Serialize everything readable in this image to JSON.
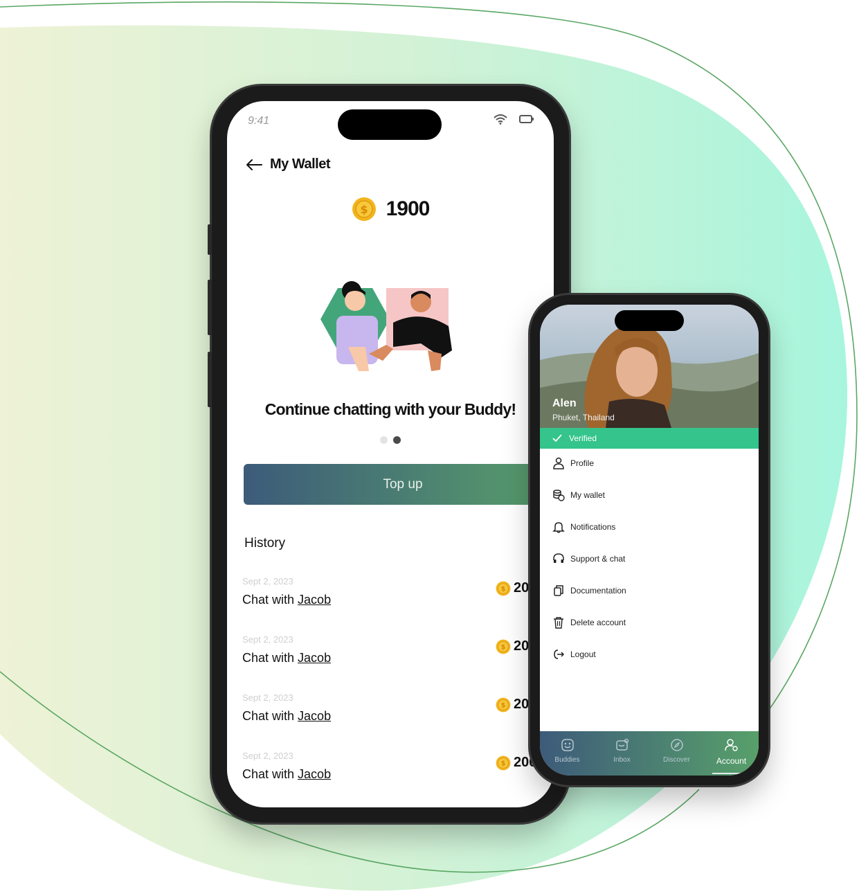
{
  "wallet_screen": {
    "status": {
      "time": "9:41"
    },
    "header": {
      "title": "My Wallet",
      "back_icon": "arrow-left-icon"
    },
    "balance": {
      "value": "1900",
      "icon": "coin-icon"
    },
    "tagline": "Continue chatting with your Buddy!",
    "pager": {
      "count": 2,
      "active": 1
    },
    "topup_label": "Top up",
    "history_title": "History",
    "history": [
      {
        "date": "Sept 2, 2023",
        "prefix": "Chat with ",
        "name": "Jacob",
        "amount": "20"
      },
      {
        "date": "Sept 2, 2023",
        "prefix": "Chat with ",
        "name": "Jacob",
        "amount": "20"
      },
      {
        "date": "Sept 2, 2023",
        "prefix": "Chat with ",
        "name": "Jacob",
        "amount": "20"
      },
      {
        "date": "Sept 2, 2023",
        "prefix": "Chat with ",
        "name": "Jacob",
        "amount": "200"
      }
    ]
  },
  "account_screen": {
    "profile": {
      "name": "Alen",
      "location": "Phuket, Thailand"
    },
    "verified_label": "Verified",
    "menu": [
      {
        "label": "Profile",
        "icon": "user-icon"
      },
      {
        "label": "My wallet",
        "icon": "coins-stack-icon"
      },
      {
        "label": "Notifications",
        "icon": "bell-icon"
      },
      {
        "label": "Support & chat",
        "icon": "headset-icon"
      },
      {
        "label": "Documentation",
        "icon": "copy-document-icon"
      },
      {
        "label": "Delete account",
        "icon": "trash-icon"
      },
      {
        "label": "Logout",
        "icon": "logout-icon"
      }
    ],
    "tabs": [
      {
        "label": "Buddies",
        "icon": "buddies-icon"
      },
      {
        "label": "Inbox",
        "icon": "inbox-icon"
      },
      {
        "label": "Discover",
        "icon": "compass-icon"
      },
      {
        "label": "Account",
        "icon": "account-icon",
        "active": true
      }
    ]
  },
  "colors": {
    "accent_green": "#34c48c",
    "gradient_start": "#3d5b7a",
    "gradient_end": "#58a06a",
    "coin": "#f2b51e"
  }
}
